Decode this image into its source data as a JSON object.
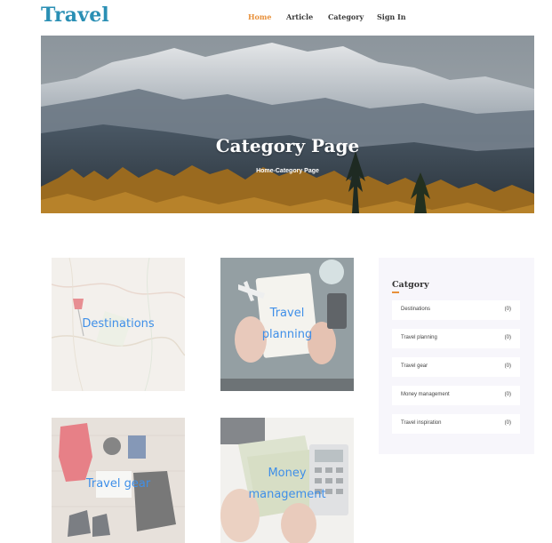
{
  "header": {
    "brand": "Travel",
    "nav": [
      {
        "label": "Home",
        "active": true
      },
      {
        "label": "Article",
        "active": false
      },
      {
        "label": "Category",
        "active": false
      },
      {
        "label": "Sign In",
        "active": false
      }
    ]
  },
  "hero": {
    "title": "Category Page",
    "breadcrumb_home": "Home",
    "breadcrumb_current": "-Category Page"
  },
  "tiles": [
    {
      "label_line1": "Destinations",
      "label_line2": ""
    },
    {
      "label_line1": "Travel",
      "label_line2": "planning"
    },
    {
      "label_line1": "Travel gear",
      "label_line2": ""
    },
    {
      "label_line1": "Money",
      "label_line2": "management"
    }
  ],
  "sidebar": {
    "title": "Catgory",
    "items": [
      {
        "name": "Destinations",
        "count": "(0)"
      },
      {
        "name": "Travel planning",
        "count": "(0)"
      },
      {
        "name": "Travel gear",
        "count": "(0)"
      },
      {
        "name": "Money management",
        "count": "(0)"
      },
      {
        "name": "Travel inspiration",
        "count": "(0)"
      }
    ]
  },
  "colors": {
    "brand": "#2a8fb4",
    "nav_active": "#e8903a",
    "tile_label": "#3f8fe8",
    "sidebar_bg": "#f7f6fb"
  }
}
